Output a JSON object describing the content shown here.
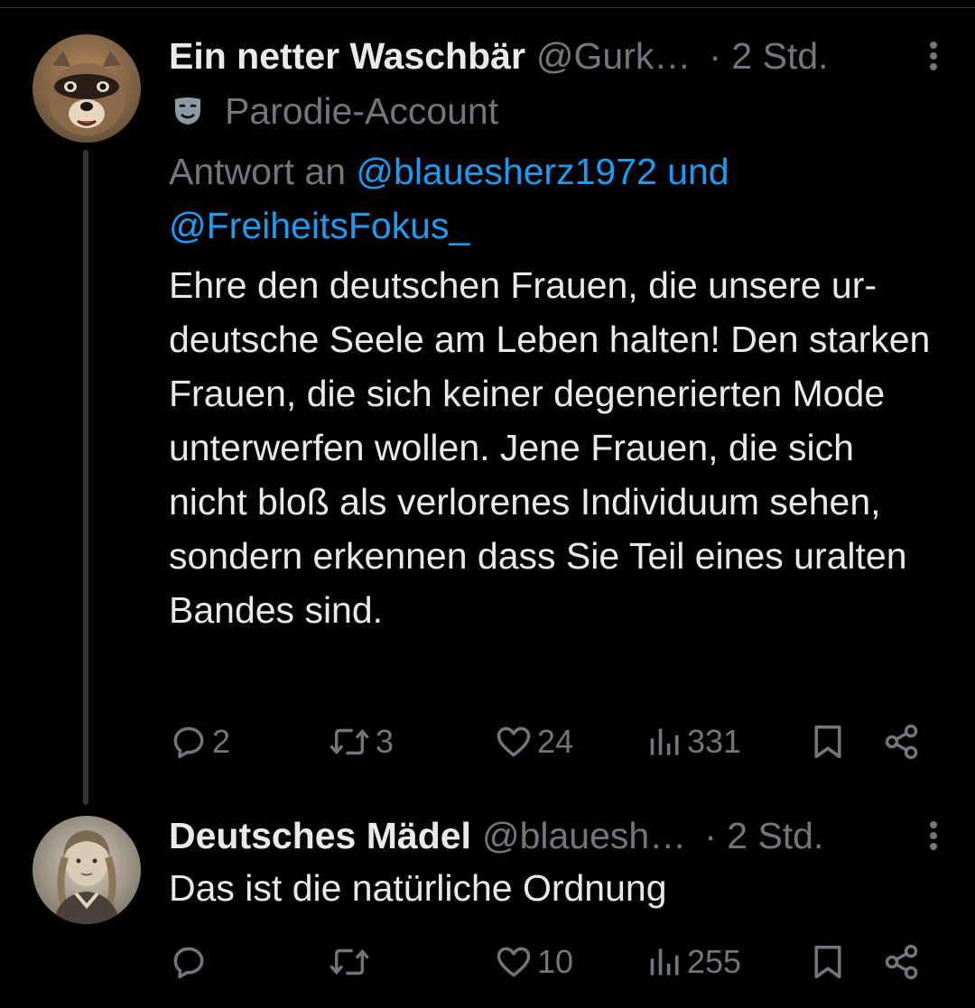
{
  "tweets": [
    {
      "display_name": "Ein netter Waschbär",
      "handle": "@Gurk…",
      "time": "· 2 Std.",
      "parody_label": "Parodie-Account",
      "reply_prefix": "Antwort an ",
      "reply_mentions": "@blauesherz1972 und",
      "reply_mentions_2": "@FreiheitsFokus_",
      "text": "Ehre den deutschen Frauen, die unsere ur-deutsche Seele am Leben halten! Den starken Frauen, die sich keiner degenerierten Mode unterwerfen wollen. Jene Frauen, die sich nicht bloß als verlorenes Individuum sehen, sondern erkennen dass Sie Teil eines uralten Bandes sind.",
      "replies": "2",
      "reposts": "3",
      "likes": "24",
      "views": "331"
    },
    {
      "display_name": "Deutsches Mädel",
      "handle": "@blauesh…",
      "time": "· 2 Std.",
      "text": "Das ist die natürliche Ordnung",
      "replies": "",
      "reposts": "",
      "likes": "10",
      "views": "255"
    }
  ],
  "icons": {
    "reply": "reply-icon",
    "repost": "repost-icon",
    "like": "heart-icon",
    "views": "views-icon",
    "bookmark": "bookmark-icon",
    "share": "share-icon",
    "more": "more-icon",
    "parody": "parody-mask-icon"
  },
  "colors": {
    "background": "#000000",
    "text": "#e7e9ea",
    "secondary": "#71767b",
    "link": "#1d9bf0"
  }
}
